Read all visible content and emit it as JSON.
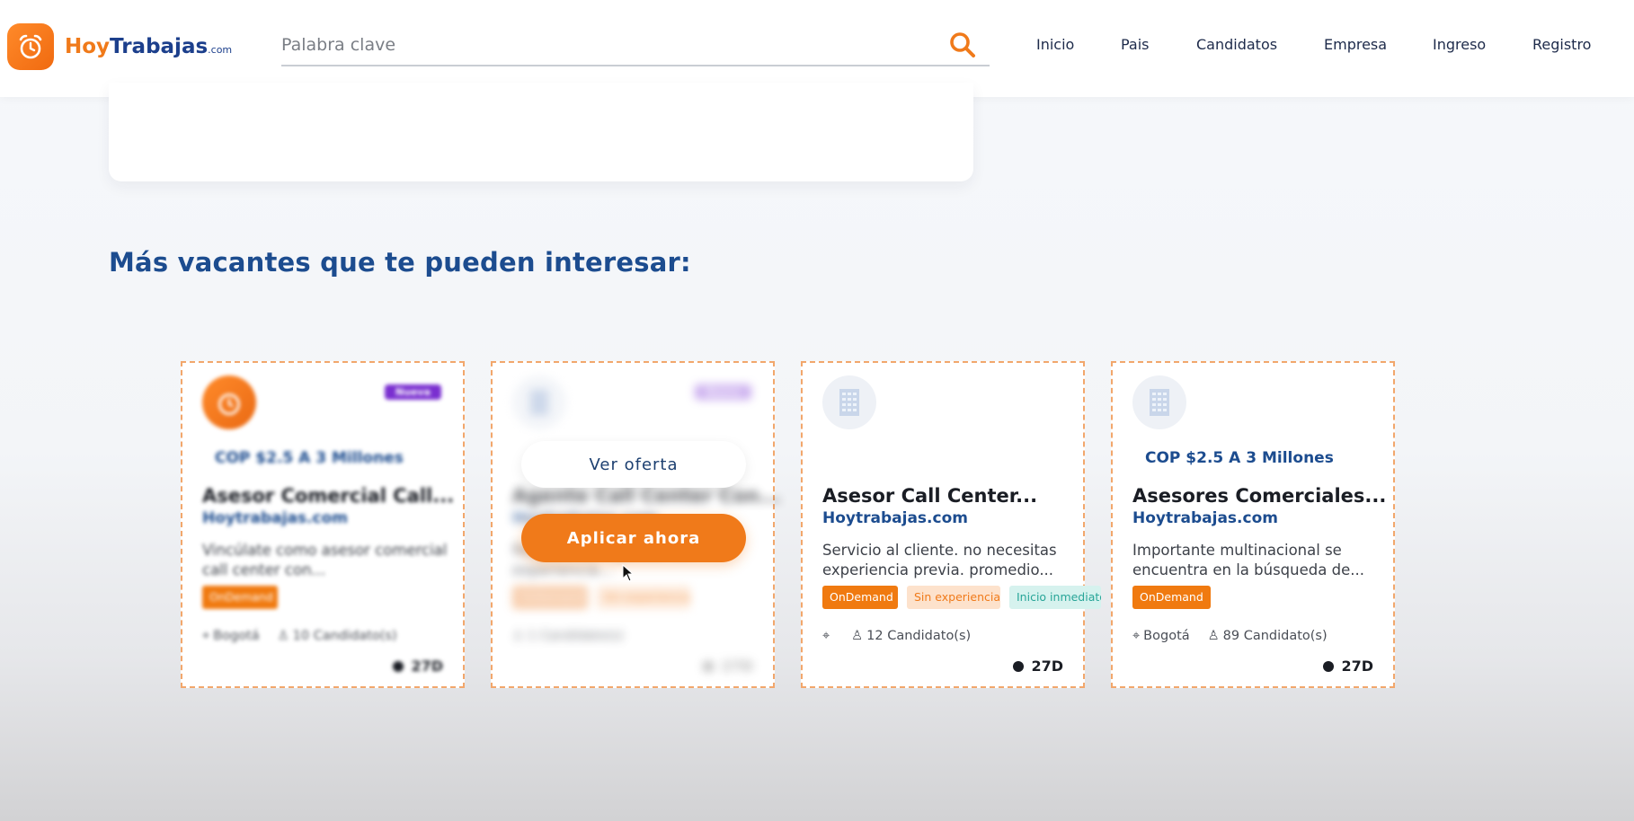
{
  "header": {
    "logo": {
      "hoy": "Hoy",
      "trabajas": "Trabajas",
      "com": ".com"
    },
    "search": {
      "placeholder": "Palabra clave",
      "value": ""
    },
    "nav": [
      "Inicio",
      "Pais",
      "Candidatos",
      "Empresa",
      "Ingreso",
      "Registro"
    ]
  },
  "section": {
    "title": "Más vacantes que te pueden interesar:"
  },
  "cards": [
    {
      "badge": "Nueva",
      "salary": "COP $2.5 A 3 Millones",
      "title": "Asesor Comercial Call...",
      "company": "Hoytrabajas.com",
      "description": "Vincúlate como asesor comercial call center con...",
      "tags": [
        "OnDemand"
      ],
      "location": "Bogotá",
      "candidates": "10 Candidato(s)",
      "days": "27D"
    },
    {
      "badge": "Nueva",
      "title": "Agente Call Center Con...",
      "company": "Hoytrabajas.com",
      "description": "Requerimos agentes con experiencia...",
      "tags": [
        "OnDemand",
        "Sin experiencia"
      ],
      "candidates": "1 Candidato(s)",
      "days": "27D",
      "overlay": {
        "view_label": "Ver oferta",
        "apply_label": "Aplicar ahora"
      }
    },
    {
      "title": "Asesor Call Center...",
      "company": "Hoytrabajas.com",
      "description": "Servicio al cliente. no necesitas experiencia previa. promedio...",
      "tags": [
        "OnDemand",
        "Sin experiencia",
        "Inicio inmediato"
      ],
      "location": "",
      "candidates": "12 Candidato(s)",
      "days": "27D"
    },
    {
      "salary": "COP $2.5 A 3 Millones",
      "title": "Asesores Comerciales...",
      "company": "Hoytrabajas.com",
      "description": "Importante multinacional se encuentra en la búsqueda de...",
      "tags": [
        "OnDemand"
      ],
      "location": "Bogotá",
      "candidates": "89 Candidato(s)",
      "days": "27D"
    }
  ],
  "colors": {
    "brand_orange": "#f07a1a",
    "brand_blue": "#1c4c8f",
    "badge_purple": "#7a2fd0"
  }
}
